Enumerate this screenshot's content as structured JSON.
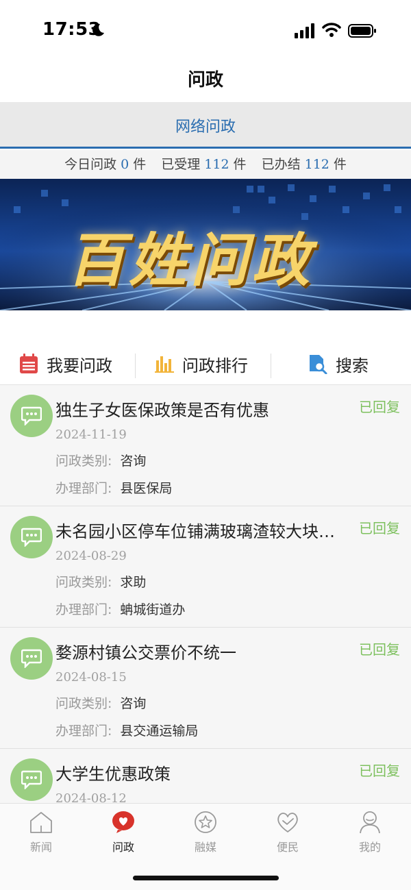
{
  "status_bar": {
    "time": "17:53"
  },
  "header": {
    "title": "问政"
  },
  "tab": {
    "label": "网络问政"
  },
  "stats": {
    "today_label": "今日问政",
    "today_value": "0",
    "accepted_label": "已受理",
    "accepted_value": "112",
    "done_label": "已办结",
    "done_value": "112",
    "unit": "件"
  },
  "banner": {
    "title": "百姓问政"
  },
  "actions": [
    {
      "label": "我要问政",
      "icon": "calendar-icon",
      "color": "#e04848"
    },
    {
      "label": "问政排行",
      "icon": "bar-chart-icon",
      "color": "#f2b43a"
    },
    {
      "label": "搜索",
      "icon": "search-doc-icon",
      "color": "#3a8ed8"
    }
  ],
  "list": {
    "category_label": "问政类别:",
    "department_label": "办理部门:",
    "items": [
      {
        "title": "独生子女医保政策是否有优惠",
        "status": "已回复",
        "date": "2024-11-19",
        "category": "咨询",
        "department": "县医保局"
      },
      {
        "title": "未名园小区停车位铺满玻璃渣较大块的石子",
        "status": "已回复",
        "date": "2024-08-29",
        "category": "求助",
        "department": "蚺城街道办"
      },
      {
        "title": "婺源村镇公交票价不统一",
        "status": "已回复",
        "date": "2024-08-15",
        "category": "咨询",
        "department": "县交通运输局"
      },
      {
        "title": "大学生优惠政策",
        "status": "已回复",
        "date": "2024-08-12",
        "category": "",
        "department": ""
      }
    ]
  },
  "tabbar": [
    {
      "label": "新闻",
      "icon": "home-icon",
      "active": false
    },
    {
      "label": "问政",
      "icon": "heart-chat-icon",
      "active": true
    },
    {
      "label": "融媒",
      "icon": "star-circle-icon",
      "active": false
    },
    {
      "label": "便民",
      "icon": "heart-check-icon",
      "active": false
    },
    {
      "label": "我的",
      "icon": "user-icon",
      "active": false
    }
  ],
  "colors": {
    "accent": "#2a6db0",
    "status_green": "#7dc05e",
    "active_red": "#d8332b",
    "avatar_green": "#9bcf82"
  }
}
